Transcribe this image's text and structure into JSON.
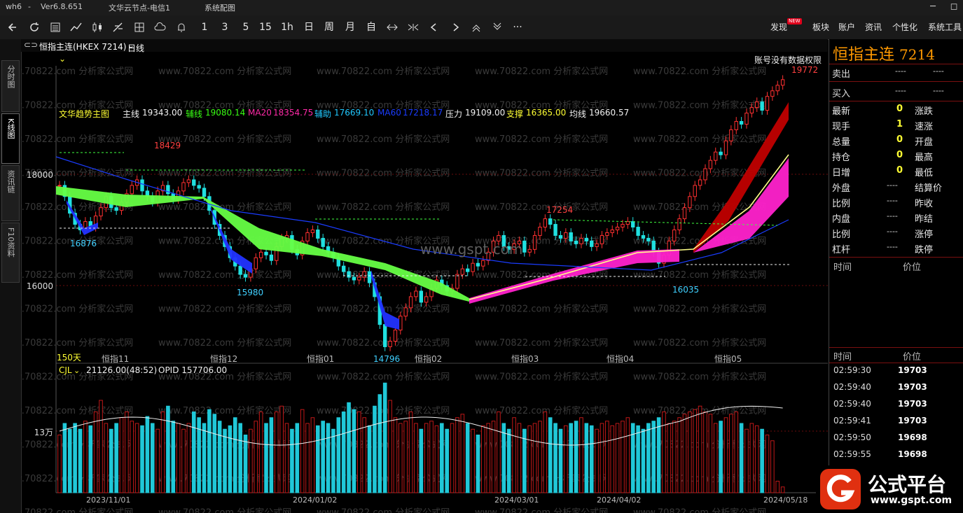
{
  "titlebar": {
    "app": "wh6",
    "dash": "-",
    "version": "Ver6.8.651",
    "server": "文华云节点-电信1",
    "sys_label": "系统配图"
  },
  "window_controls": {
    "minimize": "─",
    "restore": "◻"
  },
  "toolbar": {
    "buttons": [
      "1",
      "3",
      "5",
      "15",
      "1h",
      "日",
      "周",
      "月",
      "自"
    ],
    "more": "···",
    "menus": [
      "发现",
      "板块",
      "账户",
      "资讯",
      "个性化",
      "系统工具"
    ],
    "new_badge": "NEW"
  },
  "left_tabs": [
    "分时图",
    "K线图",
    "资讯链",
    "F10资料"
  ],
  "chart_header": {
    "symbol": "恒指主连(HKEX 7214)",
    "period": "日线"
  },
  "indicator_line": {
    "name": "文华趋势主图",
    "items": [
      {
        "label": "主线",
        "value": "19343.00",
        "color": "#f2f2f2"
      },
      {
        "label": "辅线",
        "value": "19080.14",
        "color": "#39ff14"
      },
      {
        "label": "MA20",
        "value": "18354.75",
        "color": "#ff2aa8"
      },
      {
        "label": "辅助",
        "value": "17669.10",
        "color": "#20c8ff"
      },
      {
        "label": "MA60",
        "value": "17218.17",
        "color": "#1a3cff"
      },
      {
        "label": "压力",
        "value": "19109.00",
        "color": "#f2f2f2"
      },
      {
        "label": "支撑",
        "value": "16365.00",
        "color": "#ffff33"
      },
      {
        "label": "均线",
        "value": "19660.57",
        "color": "#f2f2f2"
      }
    ],
    "notice": "账号没有数据权限"
  },
  "price_chart": {
    "y_ticks": [
      "18000",
      "16000"
    ],
    "annotations": [
      "19772",
      "18429",
      "17254",
      "16876",
      "15980",
      "14796",
      "16035"
    ],
    "days_label": "150天",
    "month_labels": [
      "恒指11",
      "恒指12",
      "恒指01",
      "恒指02",
      "恒指03",
      "恒指04",
      "恒指05"
    ],
    "watermark_site": "www.70822.com 分析家公式网",
    "watermark_center": "www.gspt.com"
  },
  "volume_chart": {
    "label": "CJL",
    "value": "21126.00(48:52)",
    "opid": "OPID 157706.00",
    "y_tick": "13万",
    "dates": [
      "2023/11/01",
      "2024/01/02",
      "2024/03/01",
      "2024/04/02",
      "2024/05/18"
    ]
  },
  "quote_panel": {
    "title": "恒指主连",
    "code": "7214",
    "sell": {
      "label": "卖出",
      "p": "----",
      "v": "----"
    },
    "buy": {
      "label": "买入",
      "p": "----",
      "v": "----"
    },
    "rows": [
      {
        "l": "最新",
        "v": "0",
        "r": "涨跌"
      },
      {
        "l": "现手",
        "v": "1",
        "r": "速涨"
      },
      {
        "l": "总量",
        "v": "0",
        "r": "开盘"
      },
      {
        "l": "持仓",
        "v": "0",
        "r": "最高"
      },
      {
        "l": "日增",
        "v": "0",
        "r": "最低"
      },
      {
        "l": "外盘",
        "v": "----",
        "r": "结算价"
      },
      {
        "l": "比例",
        "v": "----",
        "r": "昨收"
      },
      {
        "l": "内盘",
        "v": "----",
        "r": "昨结"
      },
      {
        "l": "比例",
        "v": "----",
        "r": "涨停"
      },
      {
        "l": "杠杆",
        "v": "----",
        "r": "跌停"
      }
    ],
    "col_time": "时间",
    "col_price": "价位",
    "ticks": [
      {
        "t": "02:59:30",
        "p": "19703"
      },
      {
        "t": "02:59:40",
        "p": "19703"
      },
      {
        "t": "02:59:40",
        "p": "19703"
      },
      {
        "t": "02:59:41",
        "p": "19703"
      },
      {
        "t": "02:59:50",
        "p": "19698"
      },
      {
        "t": "02:59:55",
        "p": "19698"
      }
    ]
  },
  "logo": {
    "text": "公式平台",
    "url": "www.gspt.com"
  }
}
